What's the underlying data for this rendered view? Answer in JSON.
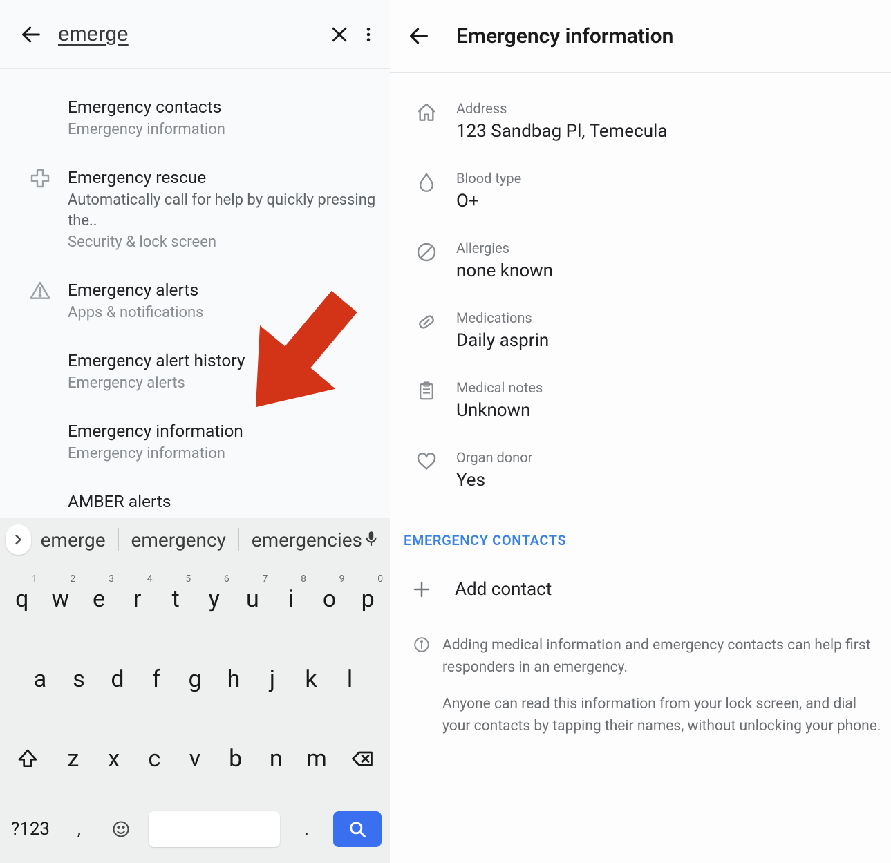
{
  "left": {
    "search_query": "emerge",
    "results": [
      {
        "title": "Emergency contacts",
        "sub": "Emergency information"
      },
      {
        "title": "Emergency rescue",
        "desc": "Automatically call for help by quickly pressing the",
        "sub": "Security & lock screen",
        "icon": "medical"
      },
      {
        "title": "Emergency alerts",
        "sub": "Apps & notifications",
        "icon": "warning"
      },
      {
        "title": "Emergency alert history",
        "sub": "Emergency alerts"
      },
      {
        "title": "Emergency information",
        "sub": "Emergency information"
      },
      {
        "title": "AMBER alerts"
      }
    ],
    "suggestions": [
      "emerge",
      "emergency",
      "emergencies"
    ],
    "keyboard": {
      "row1": [
        [
          "q",
          "1"
        ],
        [
          "w",
          "2"
        ],
        [
          "e",
          "3"
        ],
        [
          "r",
          "4"
        ],
        [
          "t",
          "5"
        ],
        [
          "y",
          "6"
        ],
        [
          "u",
          "7"
        ],
        [
          "i",
          "8"
        ],
        [
          "o",
          "9"
        ],
        [
          "p",
          "0"
        ]
      ],
      "row2": [
        "a",
        "s",
        "d",
        "f",
        "g",
        "h",
        "j",
        "k",
        "l"
      ],
      "row3": [
        "z",
        "x",
        "c",
        "v",
        "b",
        "n",
        "m"
      ],
      "sym_key": "?123",
      "comma": ",",
      "period": "."
    }
  },
  "right": {
    "title": "Emergency information",
    "fields": [
      {
        "label": "Address",
        "value": "123 Sandbag Pl, Temecula",
        "icon": "home"
      },
      {
        "label": "Blood type",
        "value": "O+",
        "icon": "drop"
      },
      {
        "label": "Allergies",
        "value": "none known",
        "icon": "slash-circle"
      },
      {
        "label": "Medications",
        "value": "Daily asprin",
        "icon": "pill"
      },
      {
        "label": "Medical notes",
        "value": "Unknown",
        "icon": "clipboard"
      },
      {
        "label": "Organ donor",
        "value": "Yes",
        "icon": "heart"
      }
    ],
    "section": "EMERGENCY CONTACTS",
    "add_contact": "Add contact",
    "info1": "Adding medical information and emergency contacts can help first responders in an emergency.",
    "info2": "Anyone can read this information from your lock screen, and dial your contacts by tapping their names, without unlocking your phone."
  }
}
